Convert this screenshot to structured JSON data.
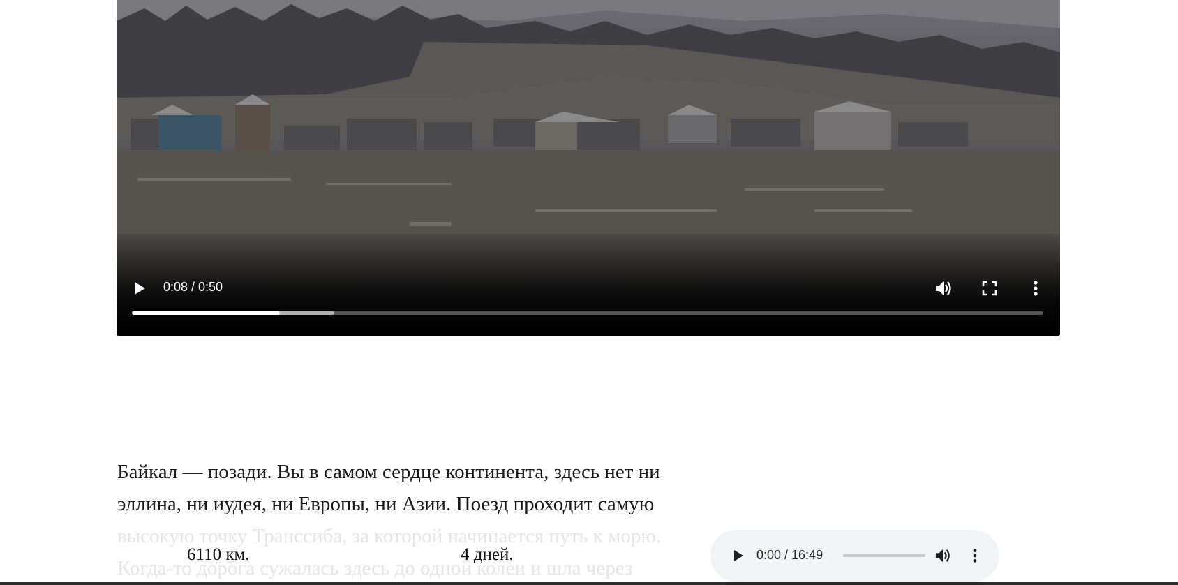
{
  "video": {
    "current_time": "0:08",
    "duration": "0:50",
    "time_display": "0:08 / 0:50",
    "played_fraction": 0.162,
    "buffered_fraction": 0.222,
    "icons": {
      "play": "play-icon",
      "volume": "volume-icon",
      "fullscreen": "fullscreen-icon",
      "more": "more-vertical-icon"
    }
  },
  "article": {
    "line1": "Байкал — позади. Вы в самом сердце континента, здесь нет ни",
    "line2": "эллина, ни иудея, ни Европы, ни Азии. Поезд проходит самую",
    "line3": "высокую точку Транссиба, за которой начинается путь к морю.",
    "line4": "Когда-то дорога сужалась здесь до одной колеи и шла через"
  },
  "stats": {
    "distance": "6110 км.",
    "duration": "4 дней."
  },
  "audio": {
    "time_display": "0:00 / 16:49",
    "current_time": "0:00",
    "duration": "16:49",
    "icons": {
      "play": "play-icon",
      "volume": "volume-icon",
      "more": "more-vertical-icon"
    }
  },
  "colors": {
    "audio_background": "#f1f3f4",
    "text": "#1a1a1a",
    "faded_text": "#e6e6e6"
  }
}
